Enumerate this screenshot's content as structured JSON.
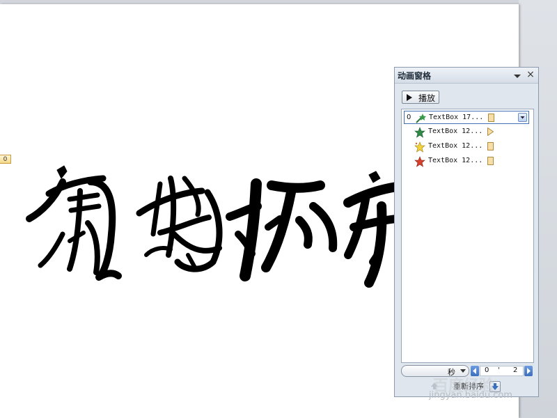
{
  "slide": {
    "badge_number": "0"
  },
  "animation_pane": {
    "title": "动画窗格",
    "play_button": "播放",
    "close_symbol": "×",
    "items": [
      {
        "order": "0",
        "name": "TextBox 17...",
        "icon": "motion-path-star-icon",
        "timing": "bar",
        "selected": true
      },
      {
        "order": "",
        "name": "TextBox 12...",
        "icon": "green-star-icon",
        "timing": "triangle",
        "selected": false
      },
      {
        "order": "",
        "name": "TextBox 12...",
        "icon": "yellow-star-icon",
        "timing": "bar",
        "selected": false
      },
      {
        "order": "",
        "name": "TextBox 12...",
        "icon": "red-star-icon",
        "timing": "bar",
        "selected": false
      }
    ],
    "seconds_label": "秒",
    "scale": [
      "0",
      "'",
      "2"
    ],
    "reorder_label": "重新排序"
  },
  "watermark": {
    "cn": "百度经验",
    "url": "jingyan.baidu.com"
  },
  "colors": {
    "pane_bg": "#dfe6ee",
    "selection_border": "#3f6fb5",
    "timing_bar": "#f6dfa8"
  }
}
